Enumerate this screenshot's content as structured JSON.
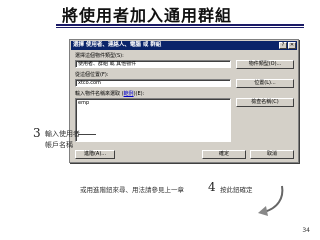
{
  "slide": {
    "title": "將使用者加入通用群組",
    "page_number": "34"
  },
  "dialog": {
    "title": "選擇 使用者、連絡人、電腦 或 群組",
    "help_button": "?",
    "close_button": "✕",
    "object_type_label": "選擇這個物件類型(S):",
    "object_type_value": "使用者、群組 或 其他物件",
    "object_types_button": "物件類型(O)...",
    "location_label": "從這個位置(F):",
    "location_value": "xtco.com",
    "locations_button": "位置(L)...",
    "names_label_prefix": "輸入物件名稱來選取 (",
    "names_label_link": "範例",
    "names_label_suffix": ")(E):",
    "names_value": "emp",
    "check_names_button": "檢查名稱(C)",
    "advanced_button": "進階(A)...",
    "ok_button": "確定",
    "cancel_button": "取消"
  },
  "annotations": {
    "step3_number": "3",
    "step3_line1": "輸入使用者",
    "step3_line2": "帳戶名稱",
    "footnote": "或用進階鈕來尋、用法請參見上一章",
    "step4_number": "4",
    "step4_text": "按此鈕確定"
  },
  "colors": {
    "titlebar": "#0a246a",
    "dialog_face": "#d4d0c8",
    "title_rule": "#1a1a66"
  }
}
